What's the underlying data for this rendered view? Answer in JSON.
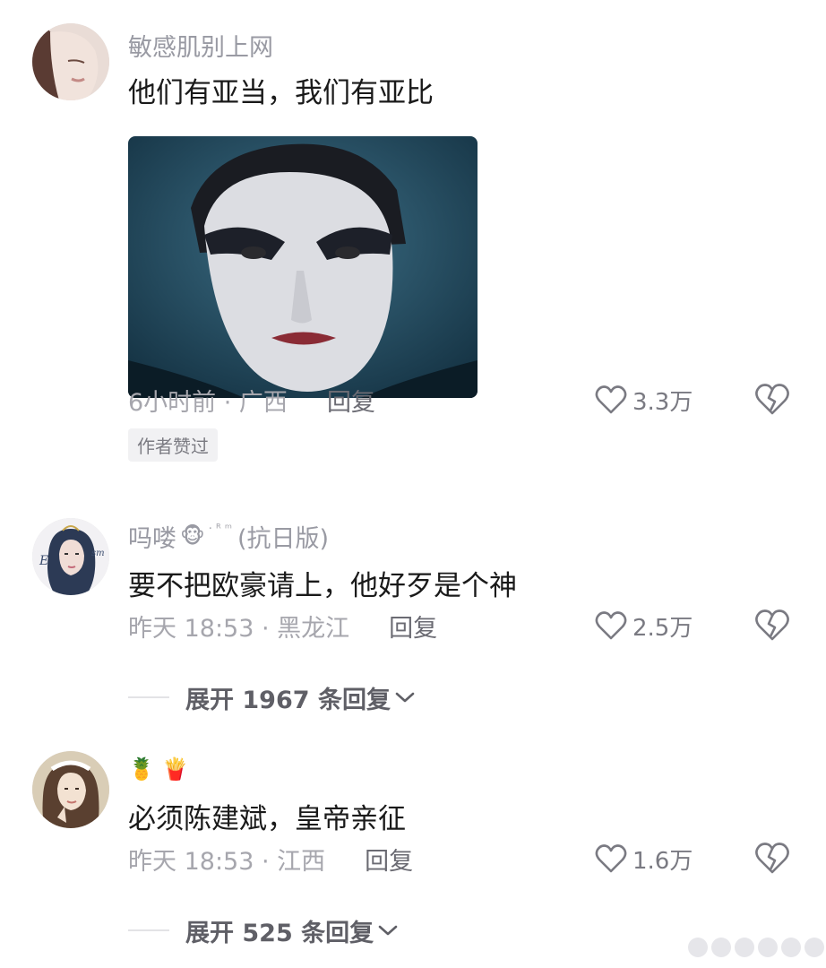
{
  "comments": [
    {
      "username": "敏感肌别上网",
      "text": "他们有亚当，我们有亚比",
      "meta": "6小时前 · 广西",
      "reply_label": "回复",
      "likes": "3.3万",
      "badge": "作者赞过"
    },
    {
      "username": "吗喽",
      "username_emoji": "🐵",
      "username_tiny": "· ᴿ ᵐ",
      "username_suffix": "(抗日版)",
      "text": "要不把欧豪请上，他好歹是个神",
      "meta": "昨天 18:53 · 黑龙江",
      "reply_label": "回复",
      "likes": "2.5万",
      "expand_label": "展开 1967 条回复"
    },
    {
      "username_emoji": "🍍 🍟",
      "text": "必须陈建斌，皇帝亲征",
      "meta": "昨天 18:53 · 江西",
      "reply_label": "回复",
      "likes": "1.6万",
      "expand_label": "展开 525 条回复"
    }
  ],
  "colors": {
    "meta_gray": "#a6a6ad",
    "text_dark": "#1a1a1a",
    "reply_gray": "#6b6b73"
  },
  "icons": [
    "heart-outline-icon",
    "broken-heart-icon",
    "chevron-down-icon"
  ]
}
